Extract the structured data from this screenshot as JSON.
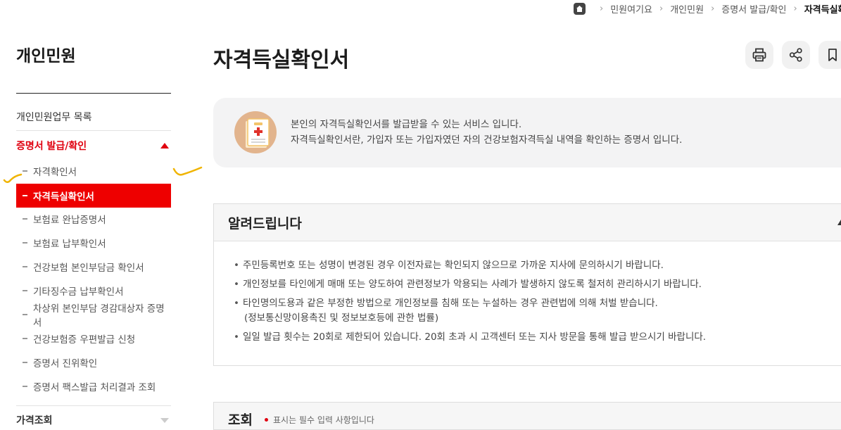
{
  "breadcrumb": {
    "items": [
      "민원여기요",
      "개인민원",
      "증명서 발급/확인",
      "자격득실확인서"
    ]
  },
  "sidebar": {
    "title": "개인민원",
    "top_link": "개인민원업무 목록",
    "section": {
      "label": "증명서 발급/확인",
      "expanded": true
    },
    "items": [
      {
        "label": "자격확인서",
        "active": false
      },
      {
        "label": "자격득실확인서",
        "active": true
      },
      {
        "label": "보험료 완납증명서",
        "active": false
      },
      {
        "label": "보험료 납부확인서",
        "active": false
      },
      {
        "label": "건강보험 본인부담금 확인서",
        "active": false
      },
      {
        "label": "기타징수금 납부확인서",
        "active": false
      },
      {
        "label": "차상위 본인부담 경감대상자 증명서",
        "active": false
      },
      {
        "label": "건강보험증 우편발급 신청",
        "active": false
      },
      {
        "label": "증명서 진위확인",
        "active": false
      },
      {
        "label": "증명서 팩스발급 처리결과 조회",
        "active": false
      }
    ],
    "next_section": {
      "label": "가격조회",
      "expanded": false
    }
  },
  "page": {
    "title": "자격득실확인서",
    "actions": [
      {
        "icon": "print-icon"
      },
      {
        "icon": "share-icon"
      },
      {
        "icon": "bookmark-icon"
      }
    ]
  },
  "info": {
    "icon": "document-icon",
    "line1": "본인의 자격득실확인서를 발급받을 수 있는 서비스 입니다.",
    "line2": "자격득실확인서란, 가입자 또는 가입자였던 자의 건강보험자격득실 내역을 확인하는 증명서 입니다."
  },
  "notice": {
    "title": "알려드립니다",
    "expanded": true,
    "items": [
      "주민등록번호 또는 성명이 변경된 경우 이전자료는 확인되지 않으므로 가까운 지사에 문의하시기 바랍니다.",
      "개인정보를 타인에게 매매 또는 양도하여 관련정보가 악용되는 사례가 발생하지 않도록 철저히 관리하시기 바랍니다.",
      "타인명의도용과 같은 부정한 방법으로 개인정보를 침해 또는 누설하는 경우 관련법에 의해 처벌 받습니다.",
      "일일 발급 횟수는 20회로 제한되어 있습니다. 20회 초과 시 고객센터 또는 지사 방문을 통해 발급 받으시기 바랍니다."
    ],
    "item3_sub": "(정보통신망이용촉진 및 정보보호등에 관한 법률)"
  },
  "search": {
    "title": "조회",
    "required_note": "표시는 필수 입력 사항입니다"
  },
  "colors": {
    "accent": "#ee0000",
    "annotation": "#f0b400"
  }
}
